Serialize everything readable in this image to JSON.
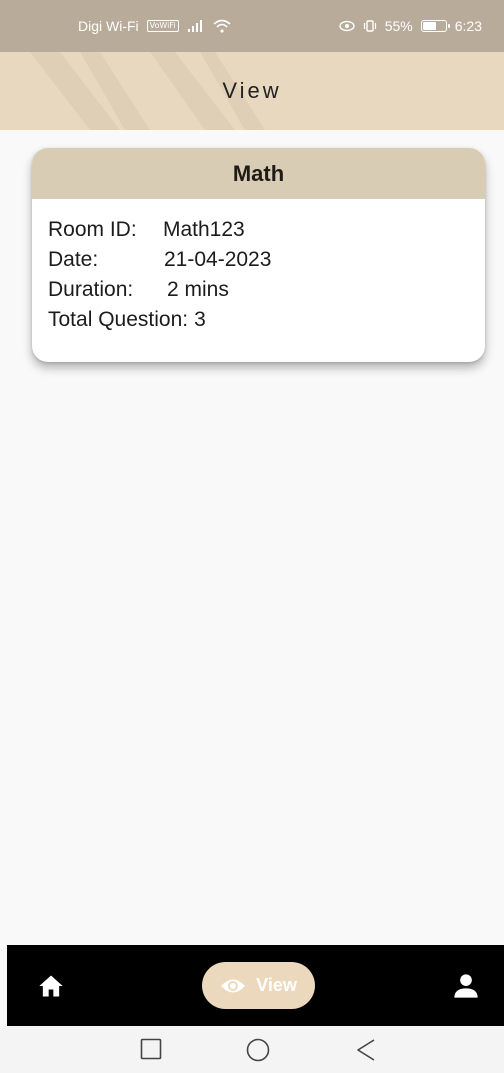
{
  "status_bar": {
    "carrier": "Digi Wi-Fi",
    "vowifi_badge": "VoWiFi",
    "battery_percent": "55%",
    "time": "6:23"
  },
  "app_bar": {
    "title": "View"
  },
  "card": {
    "title": "Math",
    "room_id_label": "Room ID:",
    "room_id_value": "Math123",
    "date_label": "Date:",
    "date_value": "21-04-2023",
    "duration_label": "Duration:",
    "duration_value": "2 mins",
    "total_question_label": "Total Question:",
    "total_question_value": "3"
  },
  "bottom_nav": {
    "items": [
      {
        "icon": "home-icon",
        "label": ""
      },
      {
        "icon": "eye-icon",
        "label": "View",
        "active": true
      },
      {
        "icon": "person-icon",
        "label": ""
      }
    ]
  },
  "colors": {
    "status_bar": "#b9ab9a",
    "app_bar": "#e8d8bf",
    "card_header": "#d8ccb5",
    "nav_active_pill": "#ecd8bd",
    "bottom_nav": "#000000"
  }
}
